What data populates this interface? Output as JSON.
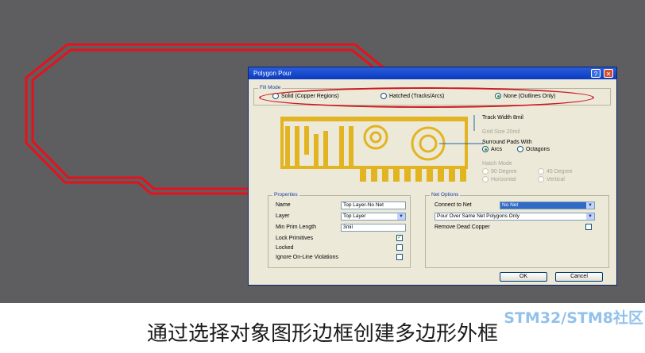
{
  "dialog": {
    "title": "Polygon Pour",
    "fill_mode": {
      "label": "Fill Mode",
      "options": [
        {
          "label": "Solid (Copper Regions)",
          "selected": false
        },
        {
          "label": "Hatched (Tracks/Arcs)",
          "selected": false
        },
        {
          "label": "None (Outlines Only)",
          "selected": true
        }
      ]
    },
    "preview": {
      "track_width": "Track Width  8mil",
      "grid_size": "Grid Size  20mil",
      "surround_label": "Surround Pads With",
      "surround_arcs": "Arcs",
      "surround_octagons": "Octagons",
      "hatch_label": "Hatch Mode",
      "hatch_options": [
        "90 Degree",
        "45 Degree",
        "Horizontal",
        "Vertical"
      ]
    },
    "properties": {
      "label": "Properties",
      "name_label": "Name",
      "name_value": "Top Layer-No Net",
      "layer_label": "Layer",
      "layer_value": "Top Layer",
      "min_prim_label": "Min Prim Length",
      "min_prim_value": "3mil",
      "lock_primitives": {
        "label": "Lock Primitives",
        "checked": true
      },
      "locked": {
        "label": "Locked",
        "checked": false
      },
      "ignore_online": {
        "label": "Ignore On-Line Violations",
        "checked": false
      }
    },
    "net_options": {
      "label": "Net Options",
      "connect_label": "Connect to Net",
      "connect_value": "No Net",
      "pour_over_value": "Pour Over Same Net Polygons Only",
      "remove_dead": {
        "label": "Remove Dead Copper",
        "checked": false
      }
    },
    "ok_label": "OK",
    "cancel_label": "Cancel"
  },
  "caption": "通过选择对象图形边框创建多边形外框",
  "watermark": "STM32/STM8社区",
  "colors": {
    "canvas": "#5e5e60",
    "outline": "#e8101a",
    "copper": "#e3b421",
    "dialog_bg": "#ece9d8",
    "titlebar": "#1b4fd0"
  }
}
